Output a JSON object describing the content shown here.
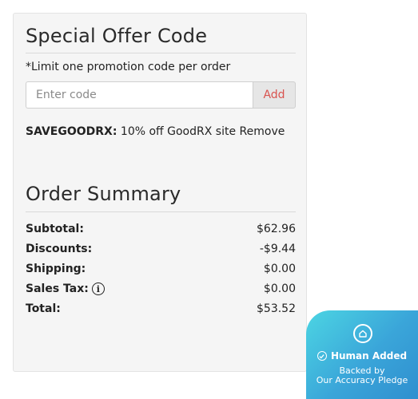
{
  "promo": {
    "title": "Special Offer Code",
    "limit_note": "*Limit one promotion code per order",
    "input_placeholder": "Enter code",
    "input_value": "",
    "add_label": "Add",
    "applied_code": "SAVEGOODRX:",
    "applied_desc": " 10% off GoodRX site ",
    "remove_label": "Remove"
  },
  "summary": {
    "title": "Order Summary",
    "rows": [
      {
        "label": "Subtotal:",
        "value": "$62.96"
      },
      {
        "label": "Discounts:",
        "value": "-$9.44"
      },
      {
        "label": "Shipping:",
        "value": "$0.00"
      },
      {
        "label": "Sales Tax:",
        "value": "$0.00",
        "info_icon": "info-icon"
      },
      {
        "label": "Total:",
        "value": "$53.52"
      }
    ]
  },
  "badge": {
    "icon": "house-icon",
    "check_icon": "check-circle-icon",
    "title": "Human Added",
    "line1": "Backed by",
    "line2": "Our Accuracy Pledge",
    "gradient_start": "#4cd5e3",
    "gradient_end": "#2f8fcf"
  },
  "colors": {
    "panel_bg": "#f5f5f5",
    "add_text": "#d9534f"
  }
}
